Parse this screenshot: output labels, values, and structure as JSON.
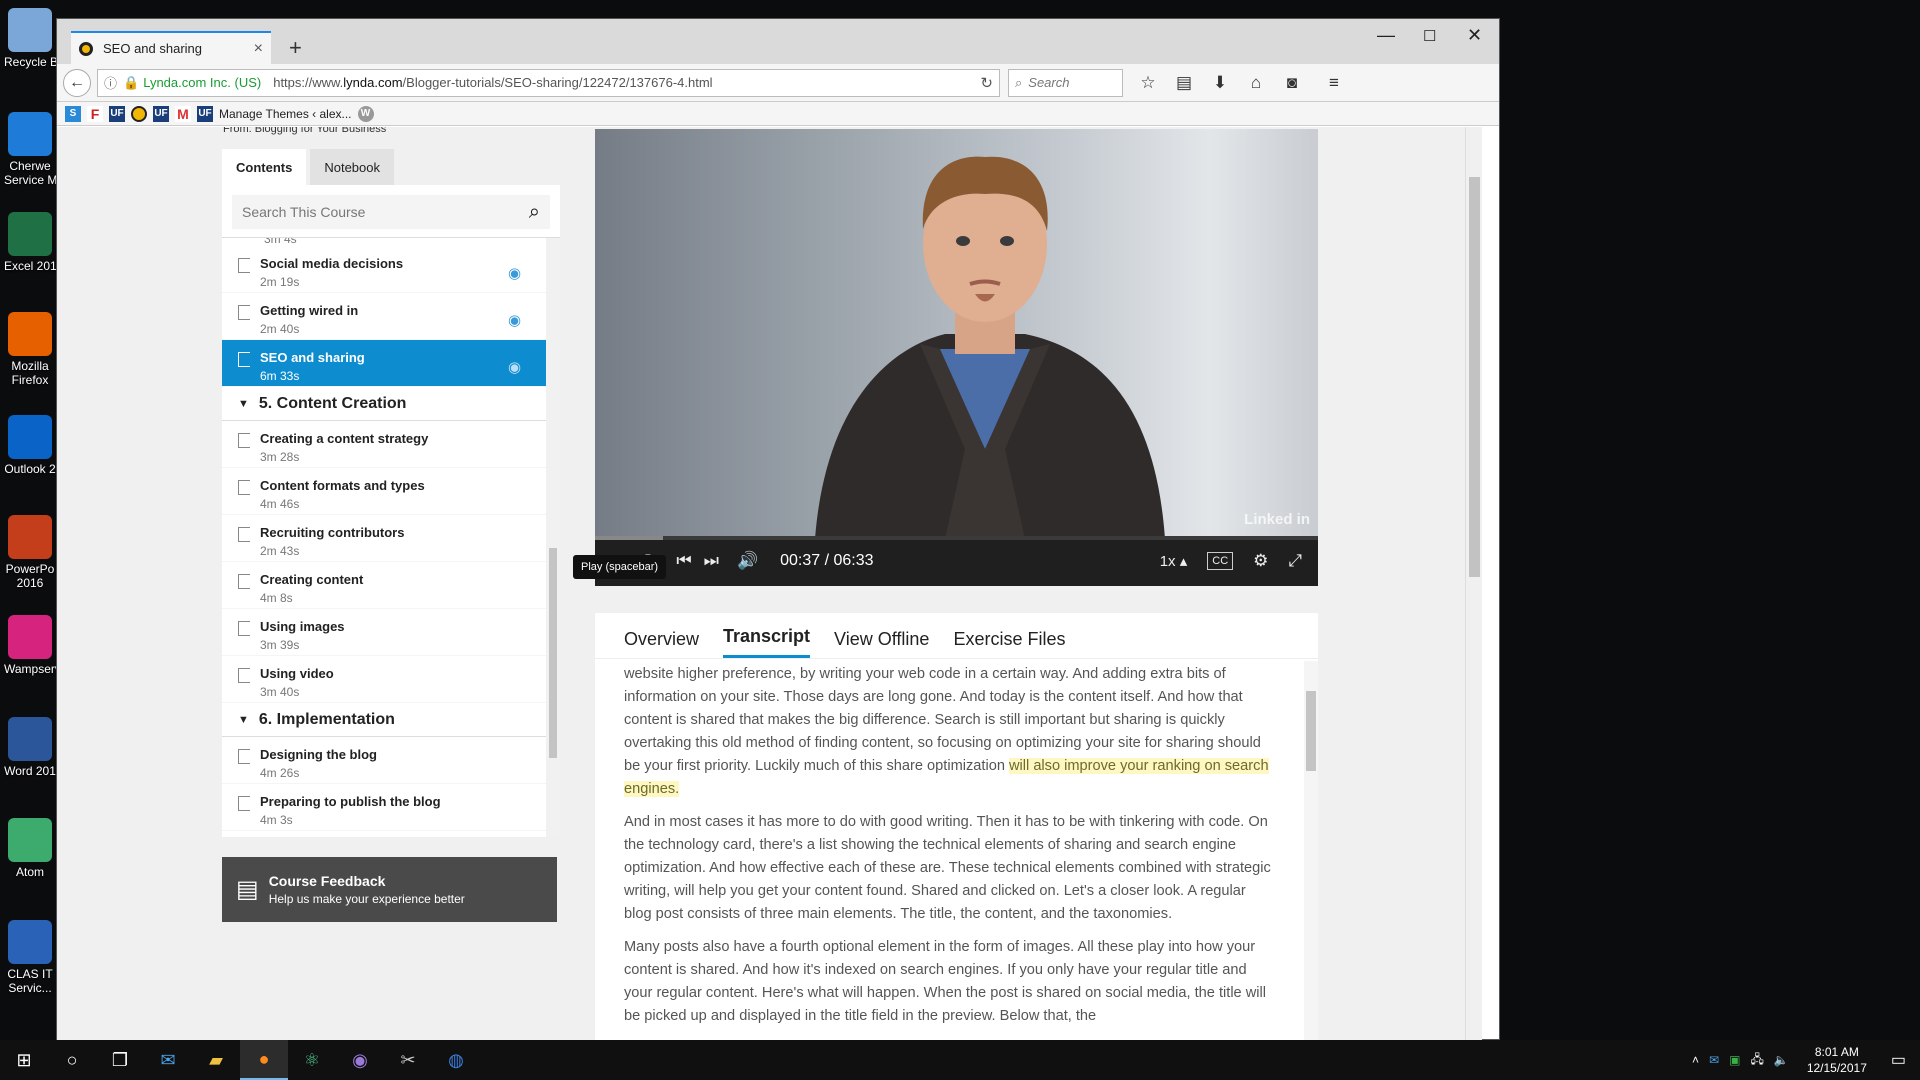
{
  "desktop": {
    "icons": [
      {
        "label": "Recycle B",
        "icon": "recycle-bin-icon",
        "color": "#7aa7d8"
      },
      {
        "label": "Cherwe\nService M",
        "icon": "cherwell-icon",
        "color": "#1e7bd8"
      },
      {
        "label": "Excel 201",
        "icon": "excel-icon",
        "color": "#1f7145"
      },
      {
        "label": "Mozilla\nFirefox",
        "icon": "firefox-icon",
        "color": "#e66000"
      },
      {
        "label": "Outlook 2",
        "icon": "outlook-icon",
        "color": "#0a64c8"
      },
      {
        "label": "PowerPo\n2016",
        "icon": "powerpoint-icon",
        "color": "#c43e1c"
      },
      {
        "label": "Wampserv",
        "icon": "wampserver-icon",
        "color": "#d6247e"
      },
      {
        "label": "Word 201",
        "icon": "word-icon",
        "color": "#2b579a"
      },
      {
        "label": "Atom",
        "icon": "atom-icon",
        "color": "#3daa6e"
      },
      {
        "label": "CLAS IT\nServic...",
        "icon": "clas-help-icon",
        "color": "#2a62b8"
      }
    ]
  },
  "browser": {
    "tab_title": "SEO and sharing",
    "site_identity": "Lynda.com Inc. (US)",
    "url_prefix": "https://www.",
    "url_host": "lynda.com",
    "url_path": "/Blogger-tutorials/SEO-sharing/122472/137676-4.html",
    "search_placeholder": "Search",
    "bookmark_label": "Manage Themes ‹ alex..."
  },
  "page": {
    "from_line": "From: Blogging for Your Business",
    "sidebar": {
      "tabs": [
        "Contents",
        "Notebook"
      ],
      "search_placeholder": "Search This Course",
      "partial_top": "3m 4s",
      "items_before": [
        {
          "title": "Social media decisions",
          "duration": "2m 19s"
        },
        {
          "title": "Getting wired in",
          "duration": "2m 40s"
        },
        {
          "title": "SEO and sharing",
          "duration": "6m 33s"
        }
      ],
      "chapter5": "5. Content Creation",
      "chapter5_items": [
        {
          "title": "Creating a content strategy",
          "duration": "3m 28s"
        },
        {
          "title": "Content formats and types",
          "duration": "4m 46s"
        },
        {
          "title": "Recruiting contributors",
          "duration": "2m 43s"
        },
        {
          "title": "Creating content",
          "duration": "4m 8s"
        },
        {
          "title": "Using images",
          "duration": "3m 39s"
        },
        {
          "title": "Using video",
          "duration": "3m 40s"
        }
      ],
      "chapter6": "6. Implementation",
      "chapter6_items": [
        {
          "title": "Designing the blog",
          "duration": "4m 26s"
        },
        {
          "title": "Preparing to publish the blog",
          "duration": "4m 3s"
        }
      ],
      "feedback_title": "Course Feedback",
      "feedback_sub": "Help us make your experience better"
    },
    "player": {
      "tooltip": "Play (spacebar)",
      "time": "00:37 / 06:33",
      "progress": 0.094,
      "speed": "1x",
      "cc": "CC",
      "watermark": "Linked in"
    },
    "content_tabs": [
      "Overview",
      "Transcript",
      "View Offline",
      "Exercise Files"
    ],
    "transcript": {
      "p1_before": "website higher preference, by writing your web code in a certain way. And adding extra bits of information on your site. Those days are long gone. And today is the content itself. And how that content is shared that makes the big difference. Search is still important but sharing is quickly overtaking this old method of finding content, so focusing on optimizing your site for sharing should be your first priority. Luckily much of this share optimization ",
      "p1_highlight": "will also improve your ranking on search engines.",
      "p2": "And in most cases it has more to do with good writing. Then it has to be with tinkering with code. On the technology card, there's a list showing the technical elements of sharing and search engine optimization. And how effective each of these are. These technical elements combined with strategic writing, will help you get your content found. Shared and clicked on. Let's a closer look. A regular blog post consists of three main elements. The title, the content, and the taxonomies.",
      "p3": "Many posts also have a fourth optional element in the form of images. All these play into how your content is shared. And how it's indexed on search engines. If you only have your regular title and your regular content. Here's what will happen. When the post is shared on social media, the title will be picked up and displayed in the title field in the preview. Below that, the"
    }
  },
  "taskbar": {
    "time": "8:01 AM",
    "date": "12/15/2017"
  }
}
